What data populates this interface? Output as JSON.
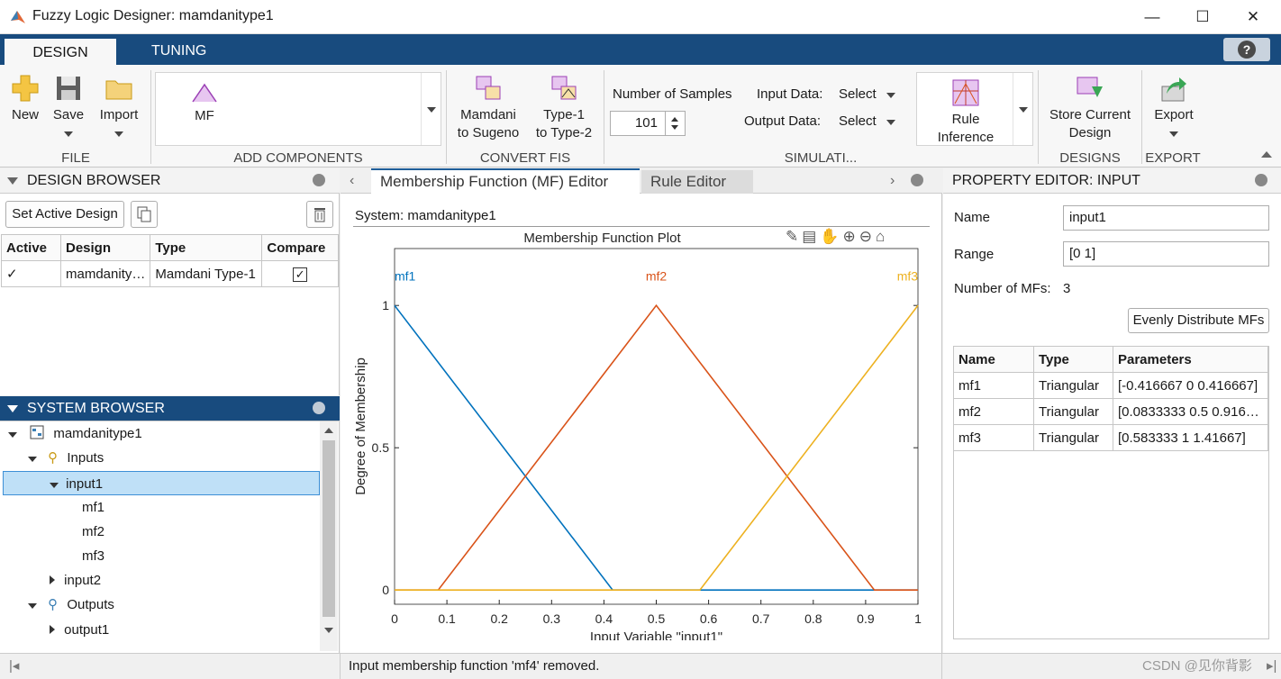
{
  "window": {
    "title": "Fuzzy Logic Designer: mamdanitype1"
  },
  "tabs": {
    "design": "DESIGN",
    "tuning": "TUNING"
  },
  "ribbon": {
    "new": "New",
    "save": "Save",
    "import": "Import",
    "file_group": "FILE",
    "mf": "MF",
    "add_components_group": "ADD COMPONENTS",
    "mamdani_line1": "Mamdani",
    "mamdani_line2": "to Sugeno",
    "type1_line1": "Type-1",
    "type1_line2": "to Type-2",
    "convert_group": "CONVERT FIS",
    "num_samples_label": "Number of Samples",
    "num_samples_value": "101",
    "input_data_label": "Input Data:",
    "input_data_value": "Select",
    "output_data_label": "Output Data:",
    "output_data_value": "Select",
    "rule_line1": "Rule",
    "rule_line2": "Inference",
    "simulation_group": "SIMULATI...",
    "store_line1": "Store Current",
    "store_line2": "Design",
    "designs_group": "DESIGNS",
    "export": "Export",
    "export_group": "EXPORT"
  },
  "design_browser": {
    "title": "DESIGN BROWSER",
    "set_active": "Set Active Design",
    "columns": [
      "Active",
      "Design",
      "Type",
      "Compare"
    ],
    "rows": [
      {
        "active": "✓",
        "design": "mamdanity…",
        "type": "Mamdani Type-1",
        "compare": "✓"
      }
    ]
  },
  "system_browser": {
    "title": "SYSTEM BROWSER",
    "root": "mamdanitype1",
    "inputs": "Inputs",
    "input1": "input1",
    "mf1": "mf1",
    "mf2": "mf2",
    "mf3": "mf3",
    "input2": "input2",
    "outputs": "Outputs",
    "output1": "output1"
  },
  "editor": {
    "tab_mf": "Membership Function (MF) Editor",
    "tab_rule": "Rule Editor",
    "system_label": "System: mamdanitype1"
  },
  "chart_data": {
    "type": "line",
    "title": "Membership Function Plot",
    "xlabel": "Input Variable \"input1\"",
    "ylabel": "Degree of Membership",
    "xlim": [
      0,
      1
    ],
    "ylim": [
      -0.05,
      1.2
    ],
    "xticks": [
      0,
      0.1,
      0.2,
      0.3,
      0.4,
      0.5,
      0.6,
      0.7,
      0.8,
      0.9,
      1
    ],
    "xtick_labels": [
      "0",
      "0.1",
      "0.2",
      "0.3",
      "0.4",
      "0.5",
      "0.6",
      "0.7",
      "0.8",
      "0.9",
      "1"
    ],
    "yticks": [
      0,
      0.5,
      1
    ],
    "ytick_labels": [
      "0",
      "0.5",
      "1"
    ],
    "grid": false,
    "series": [
      {
        "name": "mf1",
        "color": "#0072bd",
        "x": [
          0,
          0.416667,
          1
        ],
        "y": [
          1,
          0,
          0
        ],
        "label_x": 0.02
      },
      {
        "name": "mf2",
        "color": "#d95319",
        "x": [
          0,
          0.0833333,
          0.5,
          0.916667,
          1
        ],
        "y": [
          0,
          0,
          1,
          0,
          0
        ],
        "label_x": 0.5
      },
      {
        "name": "mf3",
        "color": "#edb120",
        "x": [
          0,
          0.583333,
          1
        ],
        "y": [
          0,
          0,
          1
        ],
        "label_x": 0.98
      }
    ]
  },
  "property_editor": {
    "title": "PROPERTY EDITOR: INPUT",
    "name_label": "Name",
    "name_value": "input1",
    "range_label": "Range",
    "range_value": "[0 1]",
    "num_mfs_label": "Number of MFs:",
    "num_mfs_value": "3",
    "evenly_distribute": "Evenly Distribute MFs",
    "columns": [
      "Name",
      "Type",
      "Parameters"
    ],
    "rows": [
      {
        "name": "mf1",
        "type": "Triangular",
        "params": "[-0.416667 0 0.416667]"
      },
      {
        "name": "mf2",
        "type": "Triangular",
        "params": "[0.0833333 0.5 0.916…"
      },
      {
        "name": "mf3",
        "type": "Triangular",
        "params": "[0.583333 1 1.41667]"
      }
    ]
  },
  "status": {
    "message": "Input membership function 'mf4' removed."
  },
  "watermark": "CSDN @见你背影"
}
